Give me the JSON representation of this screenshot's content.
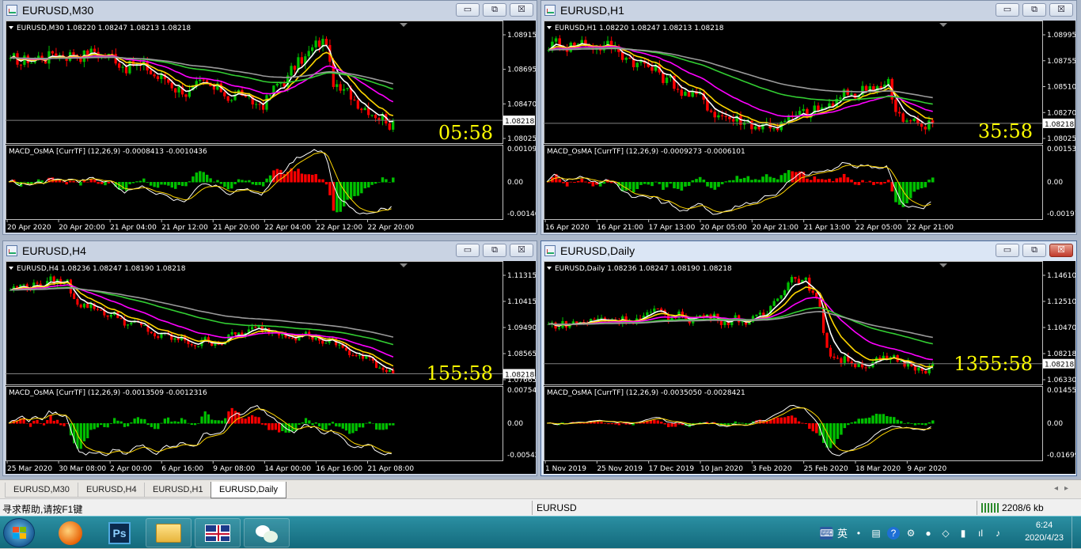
{
  "windows": [
    {
      "title": "EURUSD,M30",
      "symbol_line": "EURUSD,M30  1.08220 1.08247 1.08213 1.08218",
      "price_ticks": [
        "1.08915",
        "1.08695",
        "1.08470",
        "1.08025"
      ],
      "current_price": "1.08218",
      "timer": "05:58",
      "indicator_line": "MACD_OsMA [CurrTF] (12,26,9) -0.0008413 -0.0010436",
      "ind_ticks": [
        "0.0010905",
        "0.00",
        "-0.001466"
      ],
      "time_labels": [
        "20 Apr 2020",
        "20 Apr 20:00",
        "21 Apr 04:00",
        "21 Apr 12:00",
        "21 Apr 20:00",
        "22 Apr 04:00",
        "22 Apr 12:00",
        "22 Apr 20:00"
      ],
      "active": false
    },
    {
      "title": "EURUSD,H1",
      "symbol_line": "EURUSD,H1  1.08220 1.08247 1.08213 1.08218",
      "price_ticks": [
        "1.08995",
        "1.08755",
        "1.08510",
        "1.08270",
        "1.08025"
      ],
      "current_price": "1.08218",
      "timer": "35:58",
      "indicator_line": "MACD_OsMA [CurrTF] (12,26,9) -0.0009273 -0.0006101",
      "ind_ticks": [
        "0.0015317",
        "0.00",
        "-0.001975"
      ],
      "time_labels": [
        "16 Apr 2020",
        "16 Apr 21:00",
        "17 Apr 13:00",
        "20 Apr 05:00",
        "20 Apr 21:00",
        "21 Apr 13:00",
        "22 Apr 05:00",
        "22 Apr 21:00"
      ],
      "active": false
    },
    {
      "title": "EURUSD,H4",
      "symbol_line": "EURUSD,H4  1.08236 1.08247 1.08190 1.08218",
      "price_ticks": [
        "1.11315",
        "1.10415",
        "1.09490",
        "1.08565",
        "1.07665"
      ],
      "current_price": "1.08218",
      "timer": "155:58",
      "indicator_line": "MACD_OsMA [CurrTF] (12,26,9) -0.0013509 -0.0012316",
      "ind_ticks": [
        "0.0075434",
        "0.00",
        "-0.005420"
      ],
      "time_labels": [
        "25 Mar 2020",
        "30 Mar 08:00",
        "2 Apr 00:00",
        "6 Apr 16:00",
        "9 Apr 08:00",
        "14 Apr 00:00",
        "16 Apr 16:00",
        "21 Apr 08:00"
      ],
      "active": false
    },
    {
      "title": "EURUSD,Daily",
      "symbol_line": "EURUSD,Daily  1.08236 1.08247 1.08190 1.08218",
      "price_ticks": [
        "1.14610",
        "1.12510",
        "1.10470",
        "1.08218",
        "1.06330"
      ],
      "current_price": "1.08218",
      "timer": "1355:58",
      "indicator_line": "MACD_OsMA [CurrTF] (12,26,9) -0.0035050 -0.0028421",
      "ind_ticks": [
        "0.0145509",
        "0.00",
        "-0.016995"
      ],
      "time_labels": [
        "1 Nov 2019",
        "25 Nov 2019",
        "17 Dec 2019",
        "10 Jan 2020",
        "3 Feb 2020",
        "25 Feb 2020",
        "18 Mar 2020",
        "9 Apr 2020"
      ],
      "active": true
    }
  ],
  "window_buttons": {
    "minimize": "▭",
    "restore": "⧉",
    "close": "☒"
  },
  "tabs": [
    "EURUSD,M30",
    "EURUSD,H4",
    "EURUSD,H1",
    "EURUSD,Daily"
  ],
  "active_tab": "EURUSD,Daily",
  "tab_arrows": "◂▸",
  "status": {
    "help": "寻求帮助,请按F1键",
    "symbol": "EURUSD",
    "traffic": "2208/6 kb"
  },
  "taskbar": {
    "apps": [
      "firefox-icon",
      "photoshop-icon",
      "folder-icon",
      "uk-flag-icon",
      "wechat-icon"
    ],
    "ps_label": "Ps",
    "tray_ime": "英",
    "time": "6:24",
    "date": "2020/4/23"
  },
  "colors": {
    "bull": "#00c000",
    "bear": "#ff0000",
    "ma_white": "#ffffff",
    "ma_yellow": "#ffd700",
    "ma_magenta": "#ff00ff",
    "ma_green": "#32cd32",
    "ma_gray": "#9a9a9a",
    "timer": "#ffff00"
  }
}
